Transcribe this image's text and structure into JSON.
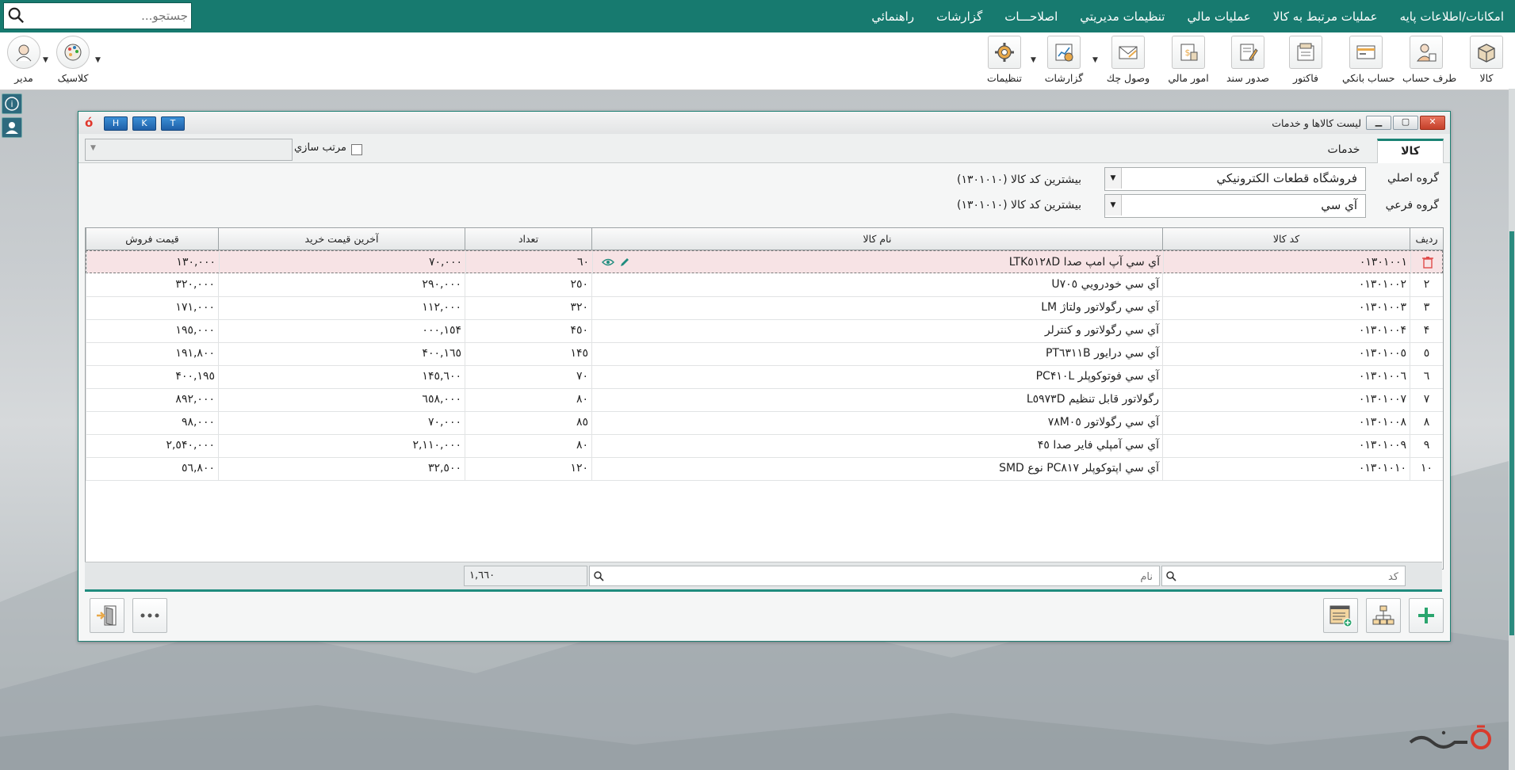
{
  "menu": {
    "items": [
      "امکانات/اطلاعات پايه",
      "عمليات مرتبط به کالا",
      "عمليات مالي",
      "تنظيمات مديريتي",
      "اصلاحـــات",
      "گزارشات",
      "راهنمائي"
    ],
    "search_placeholder": "جستجو..."
  },
  "toolbar": {
    "items": [
      "کالا",
      "طرف حساب",
      "حساب بانکي",
      "فاکتور",
      "صدور سند",
      "امور مالي",
      "وصول چك",
      "گزارشات",
      "تنظيمات"
    ],
    "left_items": [
      "کلاسیک",
      "مدير"
    ]
  },
  "window": {
    "title": "ليست کالاها و خدمات",
    "hkt": [
      "H",
      "K",
      "T"
    ],
    "tabs": [
      "کالا",
      "خدمات"
    ],
    "sort_label": "مرتب سازي",
    "main_group_label": "گروه اصلي",
    "main_group_value": "فروشگاه قطعات الکترونيکي",
    "sub_group_label": "گروه فرعي",
    "sub_group_value": "آي سي",
    "max_code_1": "بيشترين كد كالا (١٣٠١٠١٠)",
    "max_code_2": "بيشترين كد كالا (١٣٠١٠١٠)"
  },
  "grid": {
    "columns": [
      "رديف",
      "کد کالا",
      "نام کالا",
      "تعداد",
      "آخرين قيمت خريد",
      "قيمت فروش"
    ],
    "rows": [
      {
        "row": "",
        "code": "٠١٣٠١٠٠١",
        "name": "آي سي آپ امپ صدا LTK٥١٢٨D",
        "qty": "٦٠",
        "last_price": "٧٠,٠٠٠",
        "sale_price": "١٣٠,٠٠٠"
      },
      {
        "row": "٢",
        "code": "٠١٣٠١٠٠٢",
        "name": "آي سي خودرويي U٧٠٥",
        "qty": "٢٥٠",
        "last_price": "٢٩٠,٠٠٠",
        "sale_price": "٣٢٠,٠٠٠"
      },
      {
        "row": "٣",
        "code": "٠١٣٠١٠٠٣",
        "name": "آي سي رگولاتور ولتاژ LM",
        "qty": "٣٢٠",
        "last_price": "١١٢,٠٠٠",
        "sale_price": "١٧١,٠٠٠"
      },
      {
        "row": "۴",
        "code": "٠١٣٠١٠٠۴",
        "name": "آي سي رگولاتور و کنترلر",
        "qty": "۴٥٠",
        "last_price": "١٥۴,٠٠٠",
        "sale_price": "١٩٥,٠٠٠"
      },
      {
        "row": "٥",
        "code": "٠١٣٠١٠٠٥",
        "name": "آي سي درايور PT٦٣١١B",
        "qty": "١۴٥",
        "last_price": "١٦٥,۴٠٠",
        "sale_price": "١٩١,٨٠٠"
      },
      {
        "row": "٦",
        "code": "٠١٣٠١٠٠٦",
        "name": "آي سي فوتوکوپلر PC۴١٠L",
        "qty": "٧٠",
        "last_price": "١۴٥,٦٠٠",
        "sale_price": "١٩٥,۴٠٠"
      },
      {
        "row": "٧",
        "code": "٠١٣٠١٠٠٧",
        "name": "رگولاتور قابل تنظيم L٥٩٧٣D",
        "qty": "٨٠",
        "last_price": "٦٥٨,٠٠٠",
        "sale_price": "٨٩٢,٠٠٠"
      },
      {
        "row": "٨",
        "code": "٠١٣٠١٠٠٨",
        "name": "آي سي رگولاتور ٧٨M٠٥",
        "qty": "٨٥",
        "last_price": "٧٠,٠٠٠",
        "sale_price": "٩٨,٠٠٠"
      },
      {
        "row": "٩",
        "code": "٠١٣٠١٠٠٩",
        "name": "آي سي آمپلي فاير صدا ۴٥",
        "qty": "٨٠",
        "last_price": "٢,١١٠,٠٠٠",
        "sale_price": "٢,٥۴٠,٠٠٠"
      },
      {
        "row": "١٠",
        "code": "٠١٣٠١٠١٠",
        "name": "آي سي اپتوکوپلر PC٨١٧ نوع SMD",
        "qty": "١٢٠",
        "last_price": "٣٢,٥٠٠",
        "sale_price": "٥٦,٨٠٠"
      }
    ]
  },
  "footer": {
    "code_placeholder": "کد",
    "name_placeholder": "نام",
    "total_qty": "١,٦٦٠"
  },
  "brand": "ظـلـعـ",
  "colors": {
    "accent": "#177a6f",
    "selected_row": "#f7e3e5"
  }
}
